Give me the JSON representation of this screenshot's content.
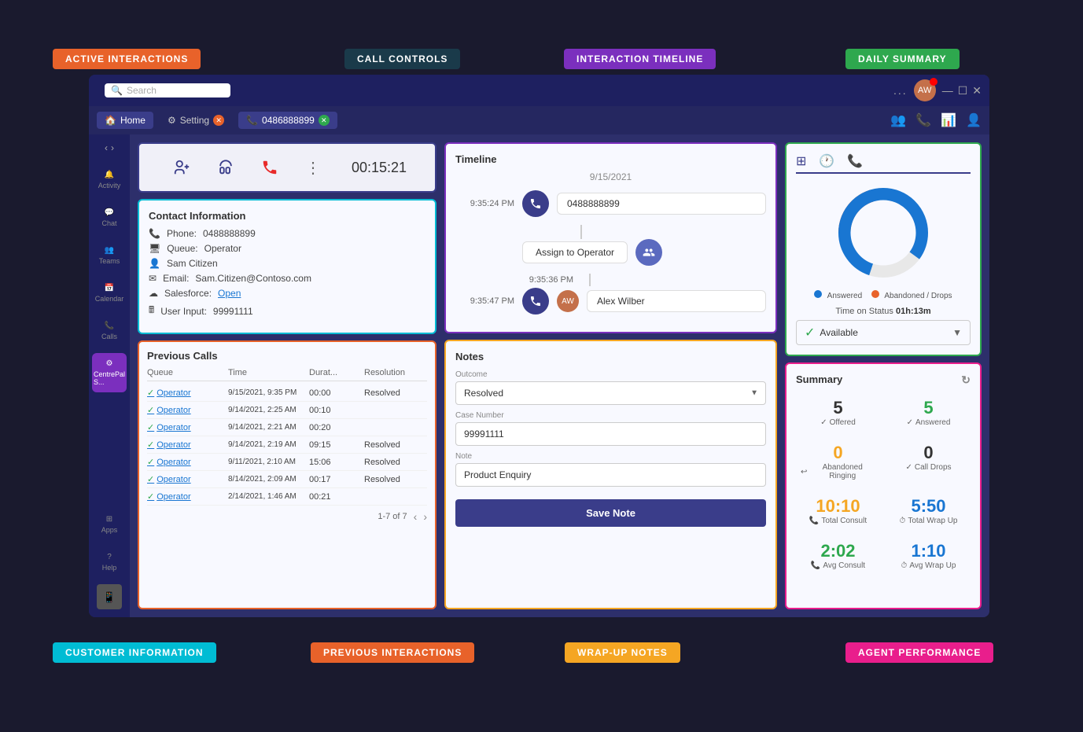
{
  "labels": {
    "active_interactions": "ACTIVE INTERACTIONS",
    "call_controls": "CALL CONTROLS",
    "interaction_timeline": "INTERACTION TIMELINE",
    "daily_summary": "DAILY SUMMARY",
    "customer_information": "CUSTOMER INFORMATION",
    "previous_interactions": "PREVIOUS INTERACTIONS",
    "wrapup_notes": "WRAP-UP NOTES",
    "agent_performance": "AGENT PERFORMANCE"
  },
  "titlebar": {
    "search_placeholder": "Search",
    "dots": "...",
    "min": "—",
    "max": "☐",
    "close": "✕"
  },
  "nav_tabs": [
    {
      "label": "Home",
      "icon": "🏠",
      "active": true
    },
    {
      "label": "Setting",
      "icon": "⚙",
      "has_close": true
    },
    {
      "label": "0486888899",
      "icon": "📞",
      "has_close": true,
      "active_tab": true
    }
  ],
  "nav_icons_right": [
    "👥",
    "📞",
    "📊",
    "👤"
  ],
  "sidebar": {
    "items": [
      {
        "label": "Activity",
        "icon": "🔔"
      },
      {
        "label": "Chat",
        "icon": "💬"
      },
      {
        "label": "Teams",
        "icon": "👥"
      },
      {
        "label": "Calendar",
        "icon": "📅"
      },
      {
        "label": "Calls",
        "icon": "📞"
      },
      {
        "label": "CentrePal S...",
        "icon": "⚙",
        "active": true
      }
    ],
    "bottom": [
      {
        "label": "Apps",
        "icon": "⊞"
      },
      {
        "label": "Help",
        "icon": "?"
      }
    ]
  },
  "call_controls": {
    "timer": "00:15:21"
  },
  "contact_info": {
    "title": "Contact Information",
    "phone_label": "Phone:",
    "phone": "0488888899",
    "queue_label": "Queue:",
    "queue": "Operator",
    "name": "Sam Citizen",
    "email_label": "Email:",
    "email": "Sam.Citizen@Contoso.com",
    "salesforce_label": "Salesforce:",
    "salesforce": "Open",
    "user_input_label": "User Input:",
    "user_input": "99991111"
  },
  "previous_calls": {
    "title": "Previous Calls",
    "columns": [
      "Queue",
      "Time",
      "Durat...",
      "Resolution"
    ],
    "rows": [
      {
        "queue": "Operator",
        "time": "9/15/2021, 9:35 PM",
        "duration": "00:00",
        "resolution": "Resolved"
      },
      {
        "queue": "Operator",
        "time": "9/14/2021, 2:25 AM",
        "duration": "00:10",
        "resolution": ""
      },
      {
        "queue": "Operator",
        "time": "9/14/2021, 2:21 AM",
        "duration": "00:20",
        "resolution": ""
      },
      {
        "queue": "Operator",
        "time": "9/14/2021, 2:19 AM",
        "duration": "09:15",
        "resolution": "Resolved"
      },
      {
        "queue": "Operator",
        "time": "9/11/2021, 2:10 AM",
        "duration": "15:06",
        "resolution": "Resolved"
      },
      {
        "queue": "Operator",
        "time": "8/14/2021, 2:09 AM",
        "duration": "00:17",
        "resolution": "Resolved"
      },
      {
        "queue": "Operator",
        "time": "2/14/2021, 1:46 AM",
        "duration": "00:21",
        "resolution": ""
      }
    ],
    "pagination": "1-7 of 7"
  },
  "timeline": {
    "title": "Timeline",
    "date": "9/15/2021",
    "events": [
      {
        "time": "9:35:24 PM",
        "type": "phone",
        "content": "0488888899"
      },
      {
        "time": "",
        "type": "assign",
        "content": "Assign to Operator"
      },
      {
        "time": "9:35:36 PM",
        "type": "assign-icon",
        "content": ""
      },
      {
        "time": "9:35:47 PM",
        "type": "agent",
        "content": "Alex Wilber"
      }
    ]
  },
  "notes": {
    "title": "Notes",
    "outcome_label": "Outcome",
    "outcome_value": "Resolved",
    "case_number_label": "Case Number",
    "case_number": "99991111",
    "note_label": "Note",
    "note_value": "Product Enquiry",
    "save_button": "Save Note"
  },
  "daily_summary": {
    "title": "Daily Summary",
    "donut": {
      "answered_pct": 80,
      "abandoned_pct": 20,
      "answered_color": "#1976d2",
      "abandoned_color": "#e8622a"
    },
    "legend": [
      {
        "label": "Answered",
        "color": "#1976d2"
      },
      {
        "label": "Abandoned / Drops",
        "color": "#e8622a"
      }
    ],
    "time_on_status_label": "Time on Status",
    "time_on_status_value": "01h:13m",
    "status_value": "Available"
  },
  "summary": {
    "title": "Summary",
    "items": [
      {
        "value": "5",
        "label": "Offered",
        "color": "val-dark",
        "icon": "✓"
      },
      {
        "value": "5",
        "label": "Answered",
        "color": "val-green",
        "icon": "✓"
      },
      {
        "value": "0",
        "label": "Abandoned Ringing",
        "color": "val-orange",
        "icon": "↩"
      },
      {
        "value": "0",
        "label": "Call Drops",
        "color": "val-dark",
        "icon": "✓"
      },
      {
        "value": "10:10",
        "label": "Total Consult",
        "color": "val-orange",
        "icon": "📞"
      },
      {
        "value": "5:50",
        "label": "Total Wrap Up",
        "color": "val-blue",
        "icon": "⏱"
      },
      {
        "value": "2:02",
        "label": "Avg Consult",
        "color": "val-green",
        "icon": "📞"
      },
      {
        "value": "1:10",
        "label": "Avg Wrap Up",
        "color": "val-blue",
        "icon": "⏱"
      }
    ]
  }
}
